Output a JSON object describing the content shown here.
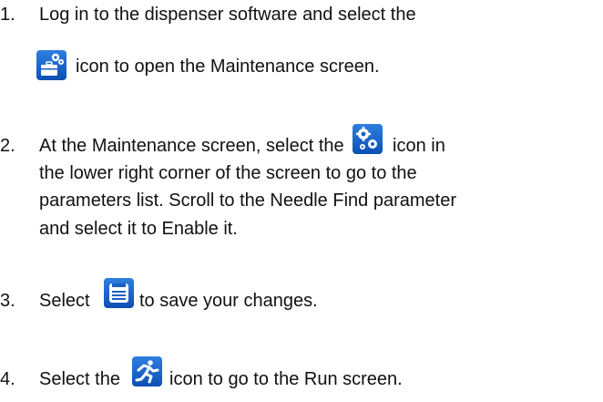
{
  "steps": [
    {
      "number": "1.",
      "lines": [
        "Log in to the dispenser software and select the",
        "icon to open the Maintenance screen."
      ],
      "icon": "maintenance-toolbox-gear-icon"
    },
    {
      "number": "2.",
      "line1_before": "At the Maintenance screen, select the",
      "line1_after": "icon in",
      "lines": [
        "the lower right corner of the screen to go to the",
        "parameters list. Scroll to the Needle Find parameter",
        "and select it to Enable it."
      ],
      "icon": "parameters-gears-icon"
    },
    {
      "number": "3.",
      "before": "Select",
      "after": "to save your changes.",
      "icon": "save-disk-icon"
    },
    {
      "number": "4.",
      "before": "Select the",
      "after": "icon to go to the Run screen.",
      "icon": "run-figure-icon"
    }
  ],
  "colors": {
    "icon_blue_top": "#2f7fe0",
    "icon_blue_bottom": "#0d4fb4",
    "text": "#111111"
  }
}
